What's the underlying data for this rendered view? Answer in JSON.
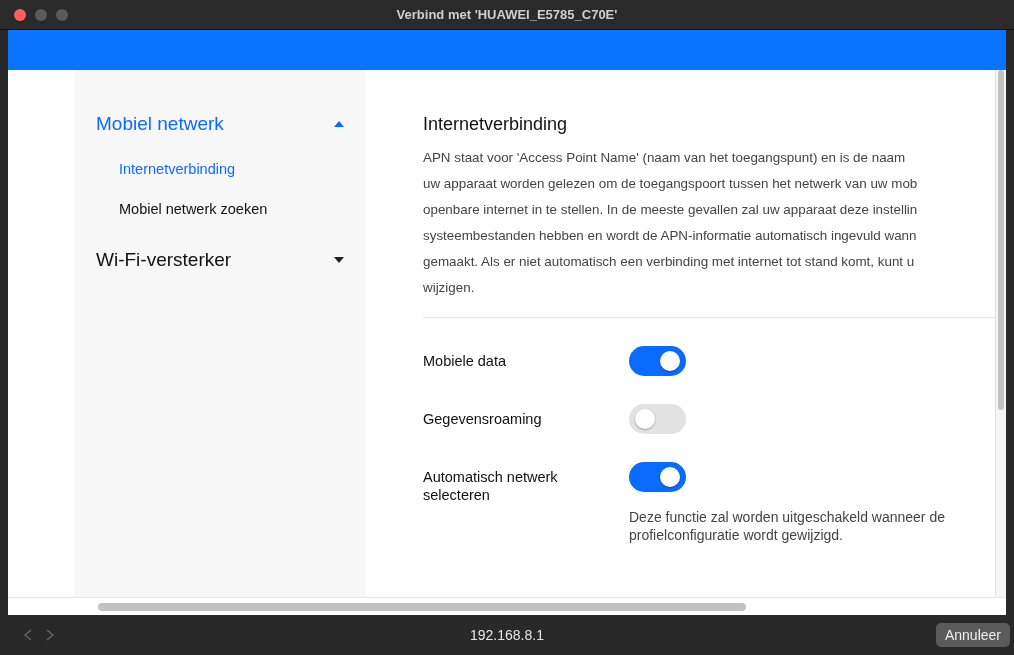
{
  "window": {
    "title": "Verbind met 'HUAWEI_E5785_C70E'"
  },
  "sidebar": {
    "groups": [
      {
        "label": "Mobiel netwerk",
        "selected": true,
        "expanded": true,
        "children": [
          {
            "label": "Internetverbinding",
            "selected": true
          },
          {
            "label": "Mobiel netwerk zoeken",
            "selected": false
          }
        ]
      },
      {
        "label": "Wi-Fi-versterker",
        "selected": false,
        "expanded": false
      }
    ]
  },
  "content": {
    "title": "Internetverbinding",
    "description_lines": [
      "APN staat voor 'Access Point Name' (naam van het toegangspunt) en is de naam",
      "uw apparaat worden gelezen om de toegangspoort tussen het netwerk van uw mob",
      "openbare internet in te stellen. In de meeste gevallen zal uw apparaat deze instellin",
      "systeembestanden hebben en wordt de APN-informatie automatisch ingevuld wann",
      "gemaakt. Als er niet automatisch een verbinding met internet tot stand komt, kunt u",
      "wijzigen."
    ],
    "settings": [
      {
        "kind": "toggle",
        "label": "Mobiele data",
        "on": true
      },
      {
        "kind": "toggle",
        "label": "Gegevensroaming",
        "on": false
      },
      {
        "kind": "toggle",
        "label": "Automatisch netwerk selecteren",
        "on": true,
        "note": "Deze functie zal worden uitgeschakeld wanneer de profielconfiguratie wordt gewijzigd."
      }
    ]
  },
  "bottom_bar": {
    "url": "192.168.8.1",
    "cancel_button": "Annuleer"
  }
}
